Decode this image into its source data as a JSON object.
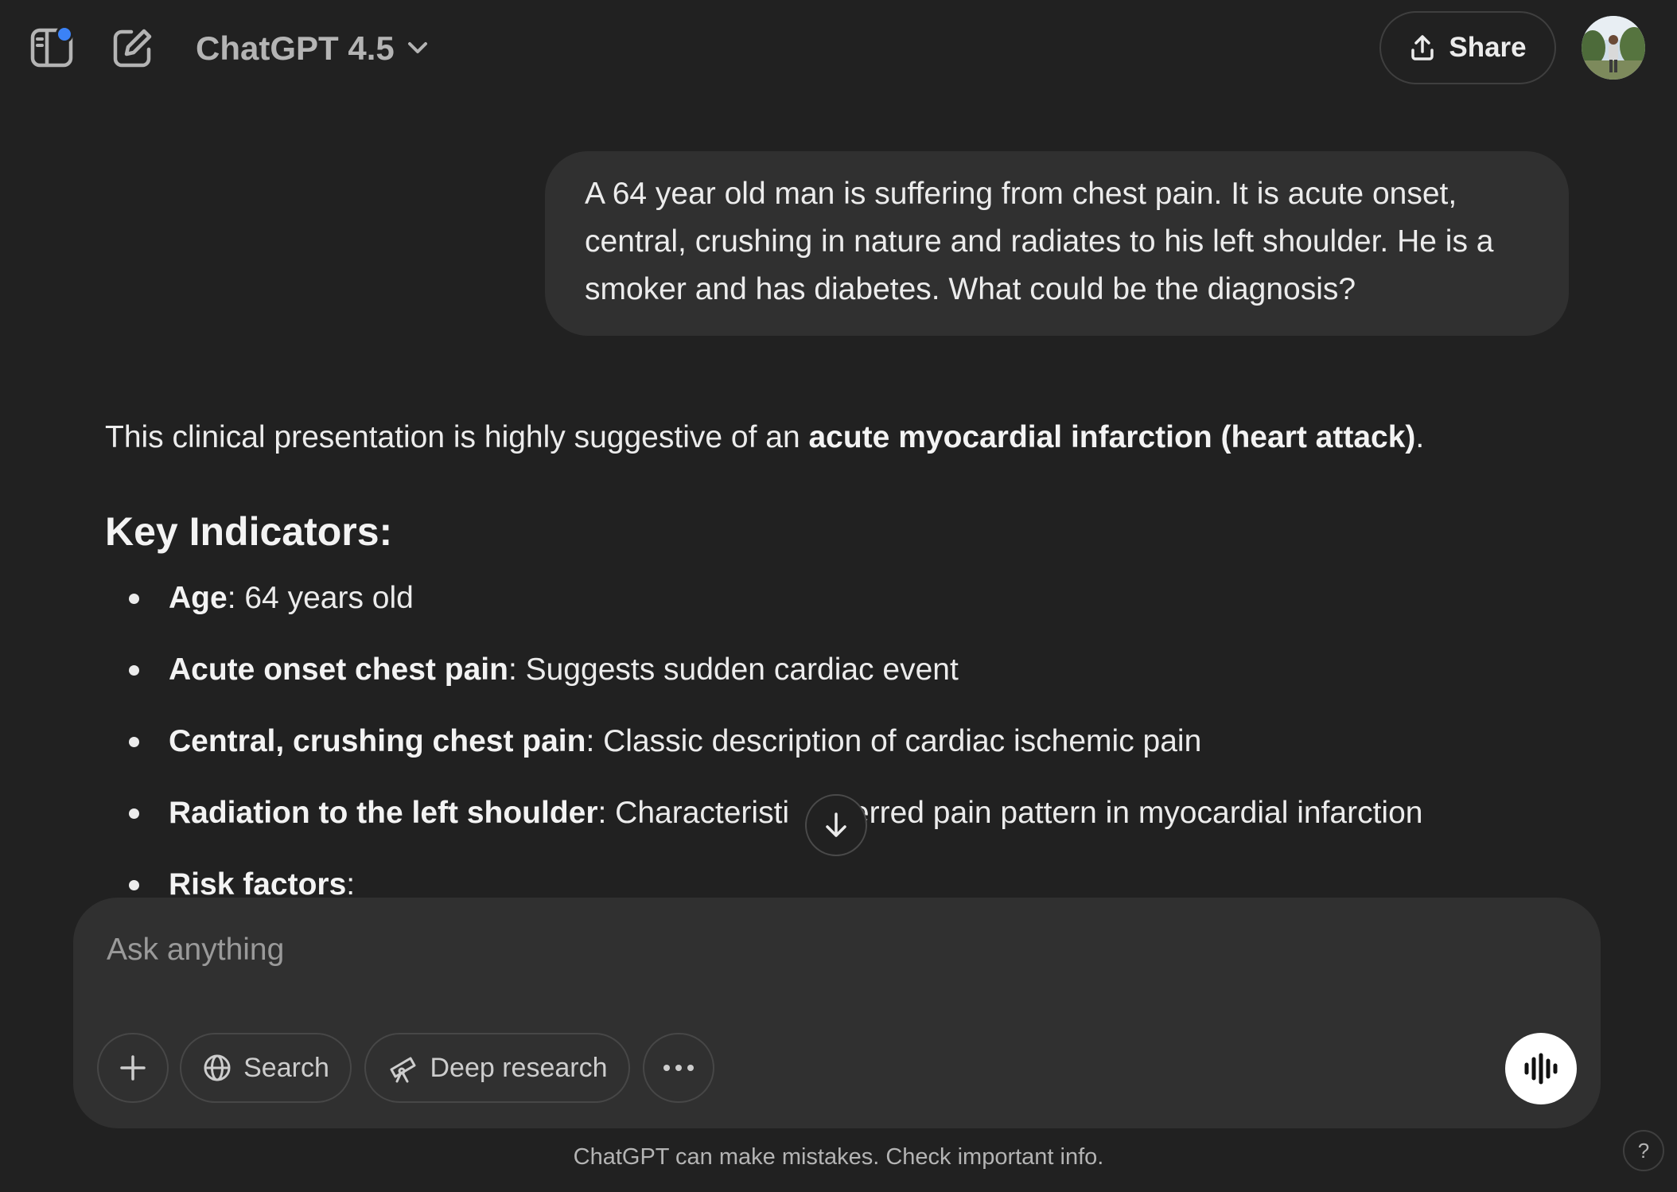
{
  "header": {
    "model_name": "ChatGPT 4.5",
    "share_label": "Share",
    "icons": {
      "sidebar": "sidebar-toggle-icon",
      "new_chat": "new-chat-edit-icon",
      "model_dropdown": "chevron-down-icon",
      "share": "share-upload-icon"
    },
    "notification_dot_color": "#3b82f6"
  },
  "conversation": {
    "user_message": "A 64 year old man is suffering from chest pain. It is acute onset, central, crushing in nature and radiates to his left shoulder. He is a smoker and has diabetes. What could be the diagnosis?",
    "assistant": {
      "intro_prefix": "This clinical presentation is highly suggestive of an ",
      "intro_bold": "acute myocardial infarction (heart attack)",
      "intro_suffix": ".",
      "section_heading": "Key Indicators:",
      "indicators": [
        {
          "term": "Age",
          "detail": ": 64 years old"
        },
        {
          "term": "Acute onset chest pain",
          "detail": ": Suggests sudden cardiac event"
        },
        {
          "term": "Central, crushing chest pain",
          "detail": ": Classic description of cardiac ischemic pain"
        },
        {
          "term": "Radiation to the left shoulder",
          "detail": ": Characteristi",
          "detail_after": "ferred pain pattern in myocardial infarction"
        },
        {
          "term": "Risk factors",
          "detail": ":"
        }
      ]
    }
  },
  "composer": {
    "placeholder": "Ask anything",
    "search_label": "Search",
    "deep_research_label": "Deep research",
    "icons": {
      "add": "plus-icon",
      "search": "globe-icon",
      "deep_research": "telescope-icon",
      "more": "ellipsis-icon",
      "voice": "voice-waveform-icon"
    }
  },
  "footer": {
    "disclaimer": "ChatGPT can make mistakes. Check important info.",
    "help_label": "?"
  },
  "colors": {
    "background": "#212121",
    "bubble": "#303030",
    "text": "#ececec",
    "muted": "#b4b4b4",
    "accent_dot": "#3b82f6"
  }
}
